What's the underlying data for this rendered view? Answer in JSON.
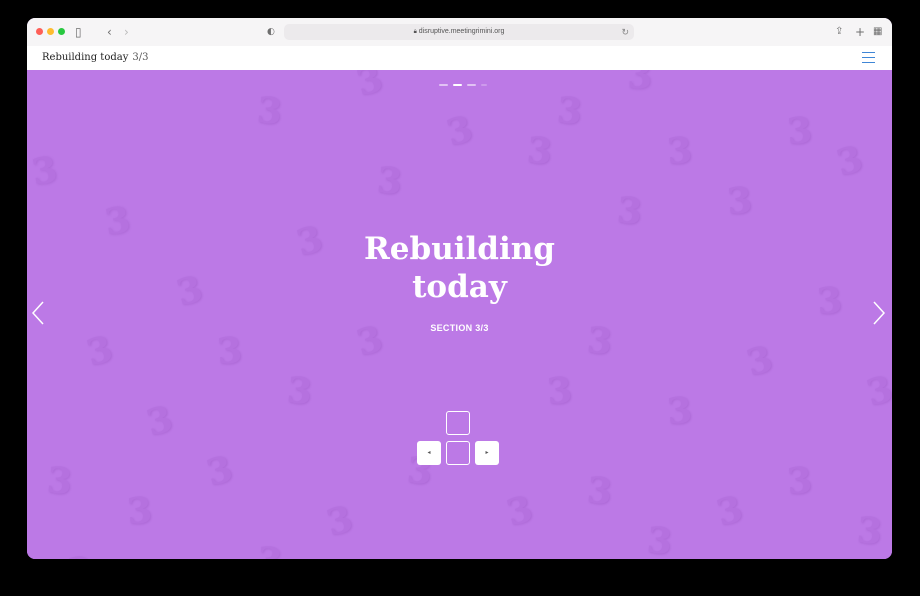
{
  "browser": {
    "url": "disruptive.meetingrimini.org",
    "icons": {
      "sidebar": "sidebar-icon",
      "back": "chevron-left-icon",
      "forward": "chevron-right-icon",
      "privacy": "shield-icon",
      "share": "share-icon",
      "new_tab": "plus-icon",
      "tabs": "tab-overview-icon"
    }
  },
  "header": {
    "title": "Rebuilding today",
    "counter": "3/3",
    "menu_icon": "hamburger-menu-icon"
  },
  "slide": {
    "title_line1": "Rebuilding",
    "title_line2": "today",
    "section_label": "SECTION 3/3",
    "background_color": "#bc79e6",
    "background_glyph": "3",
    "current_dot": 2,
    "total_dots": 4
  },
  "nav": {
    "prev_icon": "chevron-left-icon",
    "next_icon": "chevron-right-icon"
  },
  "keyboard_hint": {
    "left": "◂",
    "right": "▸"
  }
}
